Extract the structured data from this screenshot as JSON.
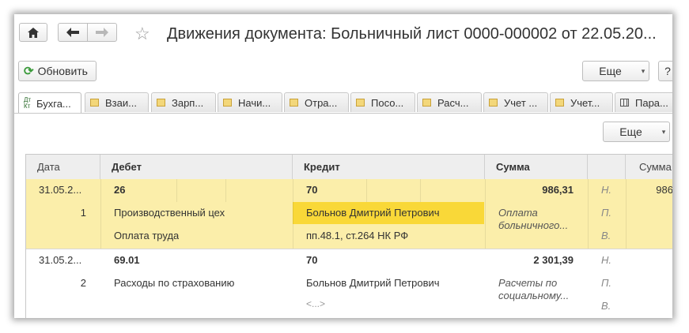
{
  "toolbar": {
    "home_icon": "home-icon",
    "back_icon": "arrow-left-icon",
    "forward_icon": "arrow-right-icon",
    "star_icon": "star-icon"
  },
  "window": {
    "title": "Движения документа: Больничный лист 0000-000002 от 22.05.20..."
  },
  "actions": {
    "refresh_label": "Обновить",
    "more_label": "Еще",
    "help_label": "?",
    "table_more_label": "Еще"
  },
  "tabs": [
    {
      "label": "Бухга..."
    },
    {
      "label": "Взаи..."
    },
    {
      "label": "Зарп..."
    },
    {
      "label": "Начи..."
    },
    {
      "label": "Отра..."
    },
    {
      "label": "Посо..."
    },
    {
      "label": "Расч..."
    },
    {
      "label": "Учет ..."
    },
    {
      "label": "Учет..."
    },
    {
      "label": "Пара..."
    }
  ],
  "columns": {
    "date": "Дата",
    "debit": "Дебет",
    "credit": "Кредит",
    "sum": "Сумма",
    "extra": "",
    "sum2": "Сумма"
  },
  "records": [
    {
      "date": "31.05.2...",
      "num": "1",
      "debit_account": "26",
      "debit_sub1": "Производственный цех",
      "debit_sub2": "Оплата труда",
      "credit_account": "70",
      "credit_sub1": "Больнов Дмитрий Петрович",
      "credit_sub2": "пп.48.1, ст.264 НК РФ",
      "sum": "986,31",
      "content_line1": "Оплата",
      "content_line2": "больничного...",
      "flag1": "Н.",
      "flag2": "П.",
      "flag3": "В.",
      "sum2": "986"
    },
    {
      "date": "31.05.2...",
      "num": "2",
      "debit_account": "69.01",
      "debit_sub1": "Расходы по страхованию",
      "debit_sub2": "",
      "credit_account": "70",
      "credit_sub1": "Больнов Дмитрий Петрович",
      "credit_sub2": "<...>",
      "sum": "2 301,39",
      "content_line1": "Расчеты по",
      "content_line2": "социальному...",
      "flag1": "Н.",
      "flag2": "П.",
      "flag3": "В.",
      "sum2": ""
    }
  ]
}
